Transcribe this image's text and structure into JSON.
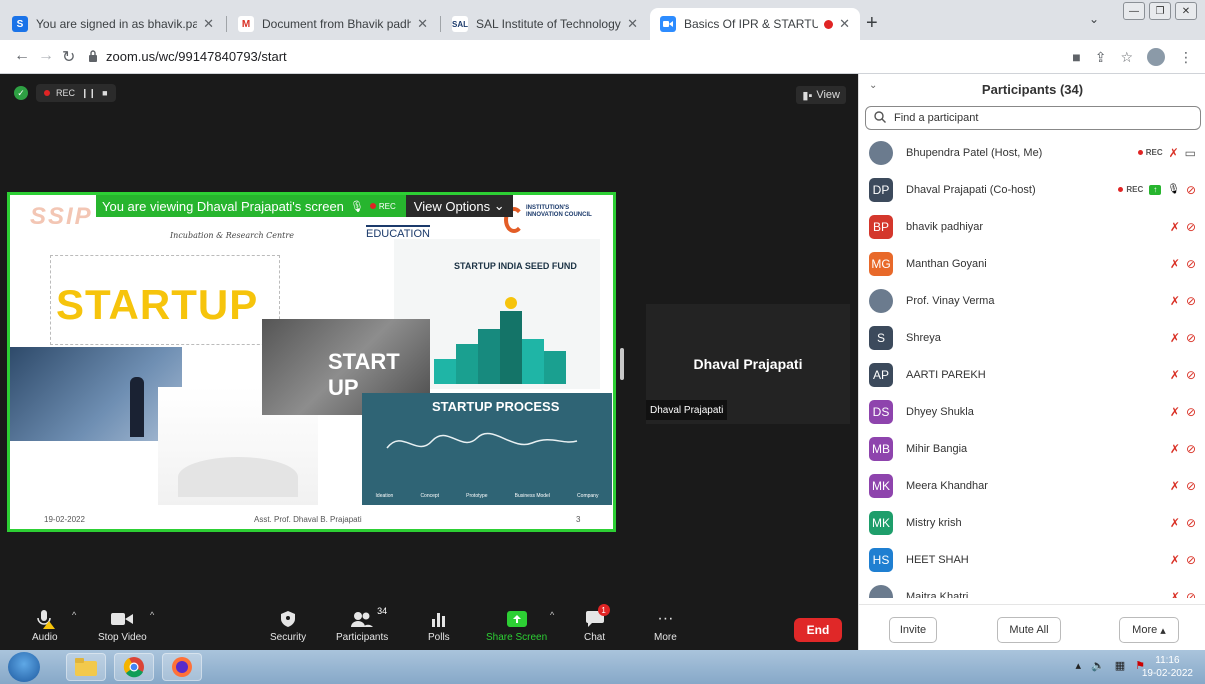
{
  "browser": {
    "tabs": [
      {
        "title": "You are signed in as bhavik.padh",
        "favicon": "S",
        "color": "#1a73e8"
      },
      {
        "title": "Document from Bhavik padhiyar",
        "favicon": "M",
        "color": "#d93025"
      },
      {
        "title": "SAL Institute of Technology & En",
        "favicon": "SAL",
        "color": "#1b3a6b"
      },
      {
        "title": "Basics Of IPR & STARTUP",
        "favicon": "zoom",
        "color": "#2d8cff"
      }
    ],
    "url": "zoom.us/wc/99147840793/start"
  },
  "meeting": {
    "rec_label": "REC",
    "view_label": "View",
    "banner_text": "You are viewing Dhaval Prajapati's screen",
    "banner_rec": "REC",
    "view_options": "View Options",
    "slide": {
      "logo_ssip": "SSIP",
      "logo_cognizant_sub": "Incubation & Research Centre",
      "logo_edu": "EDUCATION",
      "logo_iic": "INSTITUTION'S INNOVATION COUNCIL",
      "startup_word": "STARTUP",
      "hands_word": "START UP",
      "seed_title": "STARTUP INDIA SEED FUND",
      "process_title": "STARTUP PROCESS",
      "process_steps": [
        "Ideation",
        "Concept",
        "Prototype",
        "Business Model",
        "Company"
      ],
      "footer_date": "19-02-2022",
      "footer_author": "Asst. Prof. Dhaval B. Prajapati",
      "footer_page": "3"
    },
    "tile_name": "Dhaval Prajapati",
    "tile_tag": "Dhaval Prajapati"
  },
  "toolbar": {
    "audio": "Audio",
    "stop_video": "Stop Video",
    "security": "Security",
    "participants": "Participants",
    "participants_count": "34",
    "polls": "Polls",
    "share_screen": "Share Screen",
    "chat": "Chat",
    "chat_badge": "1",
    "more": "More",
    "end": "End"
  },
  "panel": {
    "title": "Participants (34)",
    "search_placeholder": "Find a participant",
    "participants": [
      {
        "name": "Bhupendra Patel (Host, Me)",
        "initials": "",
        "color": "#6b7b8e",
        "rec": "REC",
        "photo": true
      },
      {
        "name": "Dhaval Prajapati (Co-host)",
        "initials": "DP",
        "color": "#3c4a5c",
        "rec": "REC"
      },
      {
        "name": "bhavik padhiyar",
        "initials": "BP",
        "color": "#d4372c"
      },
      {
        "name": "Manthan Goyani",
        "initials": "MG",
        "color": "#e8692a"
      },
      {
        "name": "Prof. Vinay Verma",
        "initials": "",
        "color": "#6b7b8e",
        "photo": true
      },
      {
        "name": "Shreya",
        "initials": "S",
        "color": "#3c4a5c"
      },
      {
        "name": "AARTI PAREKH",
        "initials": "AP",
        "color": "#3c4a5c"
      },
      {
        "name": "Dhyey Shukla",
        "initials": "DS",
        "color": "#8e44ad"
      },
      {
        "name": "Mihir Bangia",
        "initials": "MB",
        "color": "#8e44ad"
      },
      {
        "name": "Meera Khandhar",
        "initials": "MK",
        "color": "#8e44ad"
      },
      {
        "name": "Mistry krish",
        "initials": "MK",
        "color": "#1e9e6b"
      },
      {
        "name": "HEET SHAH",
        "initials": "HS",
        "color": "#1f7fd1"
      },
      {
        "name": "Maitra Khatri",
        "initials": "",
        "color": "#6b7b8e",
        "photo": true
      }
    ],
    "invite": "Invite",
    "mute_all": "Mute All",
    "more": "More"
  },
  "taskbar": {
    "time": "11:16",
    "date": "19-02-2022"
  }
}
